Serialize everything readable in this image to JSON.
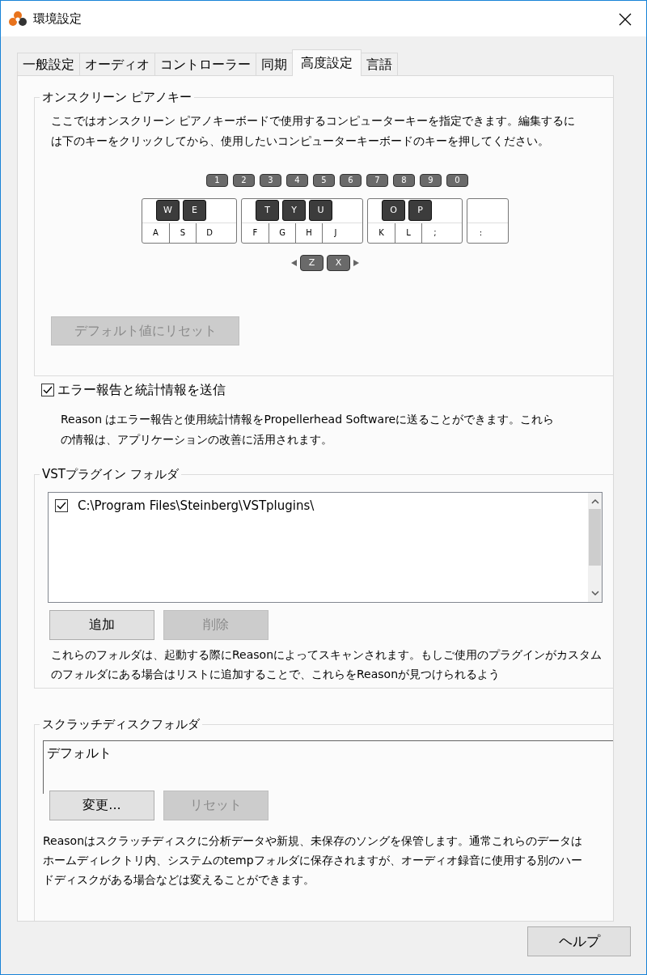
{
  "window": {
    "title": "環境設定"
  },
  "tabs": [
    {
      "label": "一般設定",
      "selected": false
    },
    {
      "label": "オーディオ",
      "selected": false
    },
    {
      "label": "コントローラー",
      "selected": false
    },
    {
      "label": "同期",
      "selected": false
    },
    {
      "label": "高度設定",
      "selected": true
    },
    {
      "label": "言語",
      "selected": false
    }
  ],
  "piano_keys": {
    "title": "オンスクリーン ピアノキー",
    "description": "ここではオンスクリーン ピアノキーボードで使用するコンピューターキーを指定できます。編集するには下のキーをクリックしてから、使用したいコンピューターキーボードのキーを押してください。",
    "number_keys": [
      "1",
      "2",
      "3",
      "4",
      "5",
      "6",
      "7",
      "8",
      "9",
      "0"
    ],
    "octaves": [
      {
        "keys": [
          {
            "label": "A",
            "black": "W"
          },
          {
            "label": "S",
            "black": "E"
          },
          {
            "label": "D"
          }
        ]
      },
      {
        "keys": [
          {
            "label": "F",
            "black": "T"
          },
          {
            "label": "G",
            "black": "Y"
          },
          {
            "label": "H",
            "black": "U"
          },
          {
            "label": "J"
          }
        ]
      },
      {
        "keys": [
          {
            "label": "K",
            "black": "O"
          },
          {
            "label": "L",
            "black": "P"
          },
          {
            "label": ";"
          }
        ]
      },
      {
        "keys": [
          {
            "label": ":"
          }
        ]
      }
    ],
    "octave_keys": [
      "Z",
      "X"
    ],
    "reset_button": {
      "label": "デフォルト値にリセット",
      "disabled": true
    }
  },
  "error_report": {
    "label": "エラー報告と統計情報を送信",
    "checked": true,
    "description": "Reason はエラー報告と使用統計情報をPropellerhead Softwareに送ることができます。これらの情報は、アプリケーションの改善に活用されます。"
  },
  "vst_folders": {
    "title": "VSTプラグイン フォルダ",
    "items": [
      {
        "path": "C:\\Program Files\\Steinberg\\VSTplugins\\",
        "checked": true
      }
    ],
    "buttons": [
      {
        "label": "追加",
        "disabled": false
      },
      {
        "label": "削除",
        "disabled": true
      }
    ],
    "description": "これらのフォルダは、起動する際にReasonによってスキャンされます。もしご使用のプラグインがカスタムのフォルダにある場合はリストに追加することで、これらをReasonが見つけられるよう"
  },
  "scratch_disk": {
    "title": "スクラッチディスクフォルダ",
    "value": "デフォルト",
    "buttons": [
      {
        "label": "変更...",
        "disabled": false
      },
      {
        "label": "リセット",
        "disabled": true
      }
    ],
    "description": "Reasonはスクラッチディスクに分析データや新規、未保存のソングを保管します。通常これらのデータはホームディレクトリ内、システムのtempフォルダに保存されますが、オーディオ録音に使用する別のハードディスクがある場合などは変えることができます。"
  },
  "help_button": {
    "label": "ヘルプ"
  }
}
